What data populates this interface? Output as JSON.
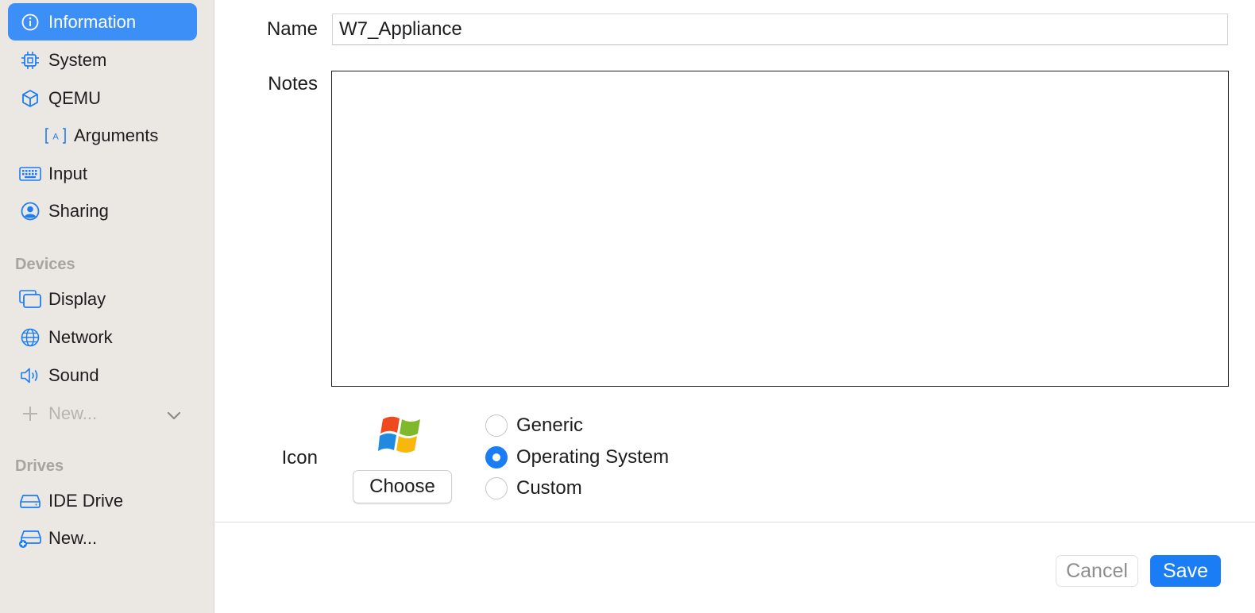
{
  "sidebar": {
    "items": [
      {
        "label": "Information",
        "icon": "info-icon"
      },
      {
        "label": "System",
        "icon": "cpu-icon"
      },
      {
        "label": "QEMU",
        "icon": "cube-icon"
      },
      {
        "label": "Arguments",
        "icon": "text-field-icon"
      },
      {
        "label": "Input",
        "icon": "keyboard-icon"
      },
      {
        "label": "Sharing",
        "icon": "person-circle-icon"
      }
    ],
    "devices_label": "Devices",
    "devices": [
      {
        "label": "Display",
        "icon": "display-icon"
      },
      {
        "label": "Network",
        "icon": "globe-icon"
      },
      {
        "label": "Sound",
        "icon": "speaker-icon"
      },
      {
        "label": "New...",
        "icon": "plus-icon"
      }
    ],
    "drives_label": "Drives",
    "drives": [
      {
        "label": "IDE Drive",
        "icon": "drive-icon"
      },
      {
        "label": "New...",
        "icon": "drive-add-icon"
      }
    ]
  },
  "form": {
    "name_label": "Name",
    "name_value": "W7_Appliance",
    "notes_label": "Notes",
    "notes_value": "",
    "icon_label": "Icon",
    "choose_label": "Choose",
    "icon_options": [
      {
        "label": "Generic",
        "selected": false
      },
      {
        "label": "Operating System",
        "selected": true
      },
      {
        "label": "Custom",
        "selected": false
      }
    ]
  },
  "footer": {
    "cancel_label": "Cancel",
    "save_label": "Save"
  },
  "colors": {
    "accent": "#1a7df5",
    "sidebar_active": "#3d8ff8",
    "sidebar_bg": "#ebe7e2"
  }
}
